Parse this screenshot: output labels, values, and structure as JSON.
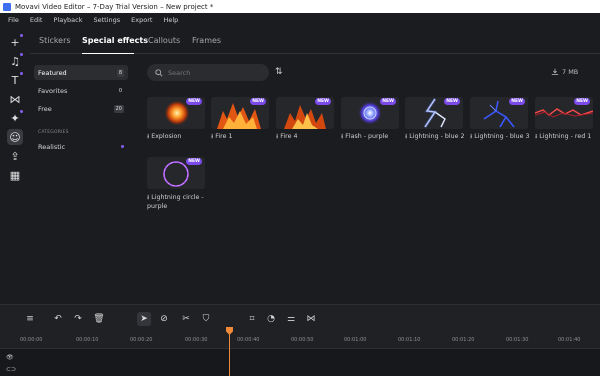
{
  "window": {
    "title": "Movavi Video Editor – 7-Day Trial Version – New project *"
  },
  "menu": [
    "File",
    "Edit",
    "Playback",
    "Settings",
    "Export",
    "Help"
  ],
  "rail": [
    {
      "name": "add-media-icon",
      "glyph": "+"
    },
    {
      "name": "music-icon",
      "glyph": "♫"
    },
    {
      "name": "titles-icon",
      "glyph": "T"
    },
    {
      "name": "transitions-icon",
      "glyph": "⋈"
    },
    {
      "name": "filters-icon",
      "glyph": "✦"
    },
    {
      "name": "stickers-icon",
      "glyph": "☺"
    },
    {
      "name": "export-icon",
      "glyph": "⇪"
    },
    {
      "name": "more-tools-icon",
      "glyph": "▦"
    }
  ],
  "tabs": [
    "Stickers",
    "Special effects",
    "Callouts",
    "Frames"
  ],
  "sidebar": {
    "categories": [
      {
        "label": "Featured",
        "count": "8"
      },
      {
        "label": "Favorites",
        "count": "0"
      },
      {
        "label": "Free",
        "count": "20"
      }
    ],
    "section_header": "CATEGORIES",
    "subcategories": [
      {
        "label": "Realistic"
      }
    ]
  },
  "search": {
    "placeholder": "Search",
    "value": ""
  },
  "download_size": "7 MB",
  "new_label": "NEW",
  "effects": [
    {
      "label": "Explosion",
      "type": "explosion"
    },
    {
      "label": "Fire 1",
      "type": "fire"
    },
    {
      "label": "Fire 4",
      "type": "fire"
    },
    {
      "label": "Flash - purple",
      "type": "flash"
    },
    {
      "label": "Lightning - blue 2",
      "type": "lightning-white"
    },
    {
      "label": "Lightning - blue 3",
      "type": "lightning-blue"
    },
    {
      "label": "Lightning - red 1",
      "type": "lightning-red"
    },
    {
      "label": "Lightning circle - purple",
      "type": "circle"
    }
  ],
  "ruler_labels": [
    "00:00:00",
    "00:00:10",
    "00:00:20",
    "00:00:30",
    "00:00:40",
    "00:00:50",
    "00:01:00",
    "00:01:10",
    "00:01:20",
    "00:01:30",
    "00:01:40"
  ],
  "colors": {
    "accent": "#7b4bea",
    "playhead": "#f08a38",
    "background": "#1b1c1f"
  }
}
